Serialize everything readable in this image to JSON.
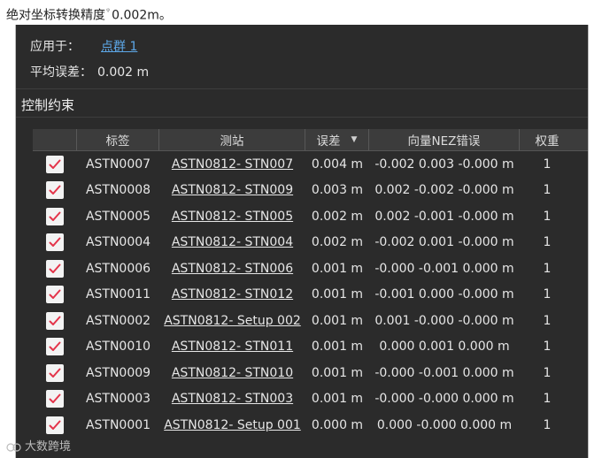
{
  "header": {
    "text_before": "绝对坐标转换精度",
    "text_after": "0.002m。"
  },
  "apply": {
    "label": "应用于：",
    "link": "点群 1"
  },
  "avg_error": {
    "label": "平均误差：",
    "value": "0.002 m"
  },
  "section": {
    "title": "控制约束"
  },
  "table": {
    "columns": [
      "",
      "标签",
      "测站",
      "误差",
      "向量NEZ错误",
      "权重"
    ],
    "sort_column": "误差",
    "rows": [
      {
        "checked": true,
        "label": "ASTN0007",
        "station": "ASTN0812- STN007",
        "error": "0.004 m",
        "nez": "-0.002 0.003 -0.000 m",
        "weight": "1"
      },
      {
        "checked": true,
        "label": "ASTN0008",
        "station": "ASTN0812- STN009",
        "error": "0.003 m",
        "nez": "0.002 -0.002 -0.000 m",
        "weight": "1"
      },
      {
        "checked": true,
        "label": "ASTN0005",
        "station": "ASTN0812- STN005",
        "error": "0.002 m",
        "nez": "0.002 -0.001 -0.000 m",
        "weight": "1"
      },
      {
        "checked": true,
        "label": "ASTN0004",
        "station": "ASTN0812- STN004",
        "error": "0.002 m",
        "nez": "-0.002 0.001 -0.000 m",
        "weight": "1"
      },
      {
        "checked": true,
        "label": "ASTN0006",
        "station": "ASTN0812- STN006",
        "error": "0.001 m",
        "nez": "-0.000 -0.001 0.000 m",
        "weight": "1"
      },
      {
        "checked": true,
        "label": "ASTN0011",
        "station": "ASTN0812- STN012",
        "error": "0.001 m",
        "nez": "-0.001 0.000 -0.000 m",
        "weight": "1"
      },
      {
        "checked": true,
        "label": "ASTN0002",
        "station": "ASTN0812- Setup 002",
        "error": "0.001 m",
        "nez": "0.001 -0.000 -0.000 m",
        "weight": "1"
      },
      {
        "checked": true,
        "label": "ASTN0010",
        "station": "ASTN0812- STN011",
        "error": "0.001 m",
        "nez": "0.000 0.001 0.000 m",
        "weight": "1"
      },
      {
        "checked": true,
        "label": "ASTN0009",
        "station": "ASTN0812- STN010",
        "error": "0.001 m",
        "nez": "-0.000 -0.001 0.000 m",
        "weight": "1"
      },
      {
        "checked": true,
        "label": "ASTN0003",
        "station": "ASTN0812- STN003",
        "error": "0.001 m",
        "nez": "-0.000 -0.000 0.000 m",
        "weight": "1"
      },
      {
        "checked": true,
        "label": "ASTN0001",
        "station": "ASTN0812- Setup 001",
        "error": "0.000 m",
        "nez": "0.000 -0.000 0.000 m",
        "weight": "1"
      }
    ]
  },
  "watermark": {
    "text": "大数跨境"
  },
  "colors": {
    "panel_bg": "#2b2b2b",
    "link": "#5da8e8",
    "check": "#e3344a"
  }
}
